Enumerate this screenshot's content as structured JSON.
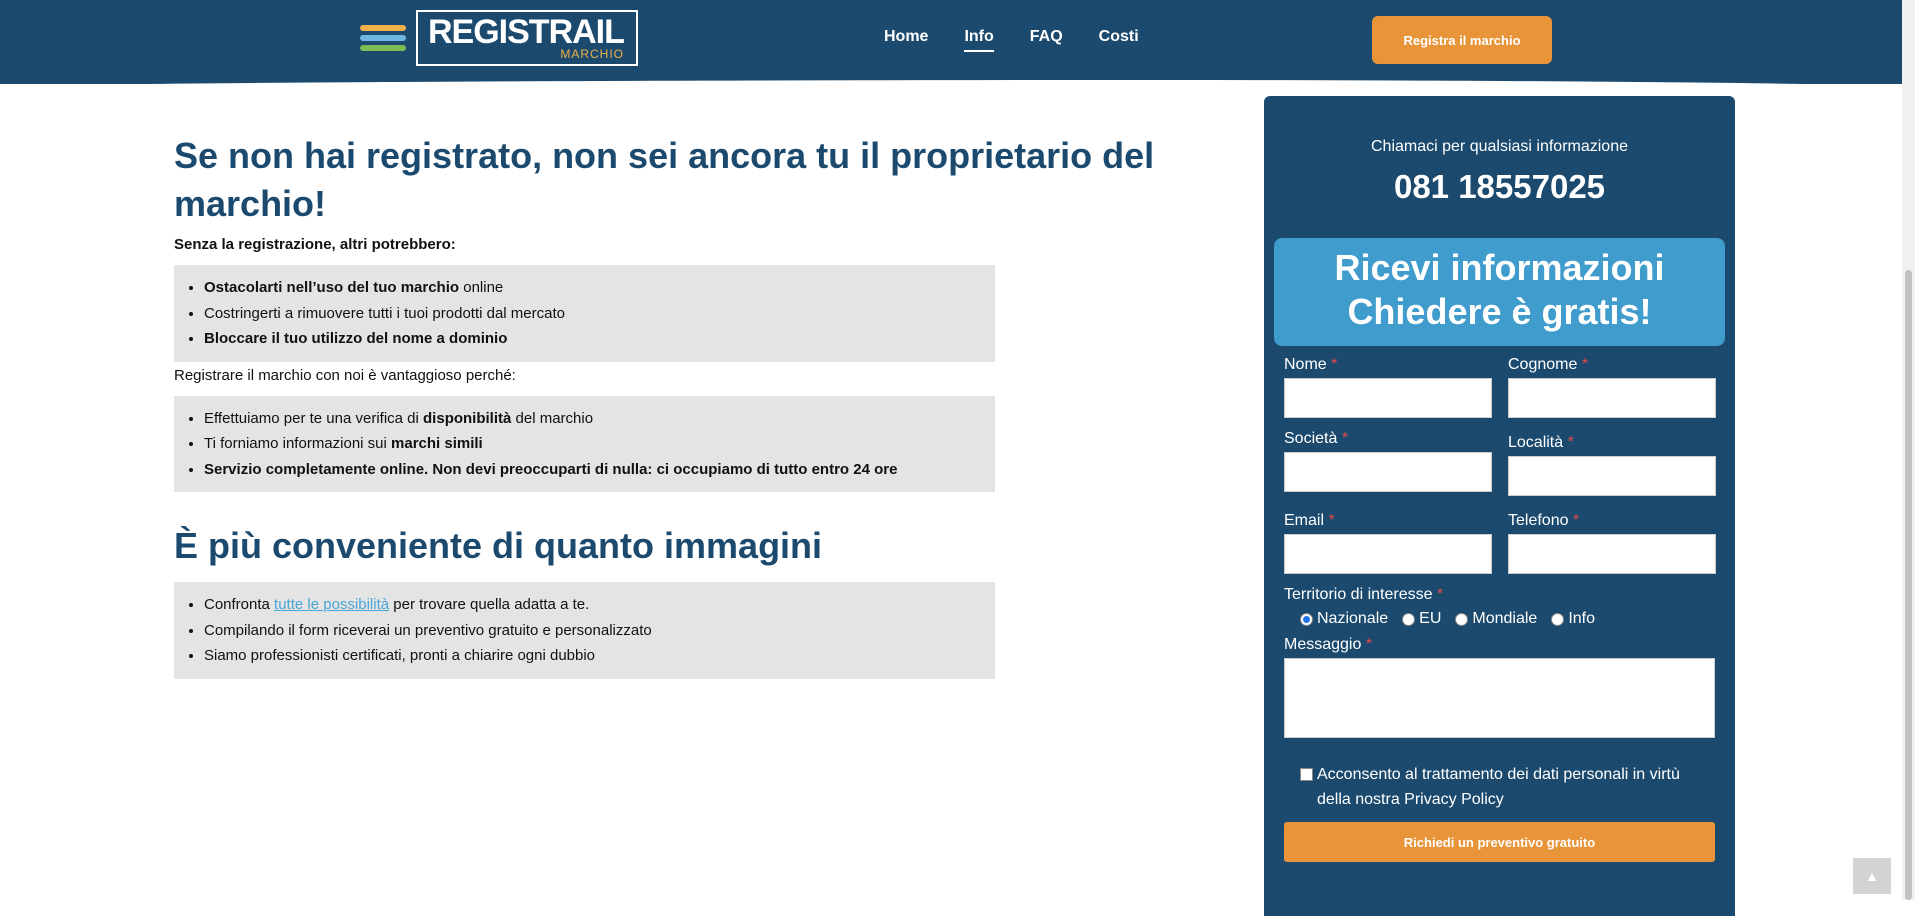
{
  "header": {
    "logo_text": "REGISTRAIL",
    "logo_sub": "MARCHIO",
    "logo_stripe_colors": [
      "#f0b04a",
      "#6fb7e3",
      "#7dbb55"
    ],
    "nav": [
      {
        "label": "Home",
        "active": false
      },
      {
        "label": "Info",
        "active": true
      },
      {
        "label": "FAQ",
        "active": false
      },
      {
        "label": "Costi",
        "active": false
      }
    ],
    "cta_label": "Registra il marchio"
  },
  "main": {
    "h1": "Se non hai registrato, non sei ancora tu il proprietario del marchio!",
    "lead": "Senza la registrazione, altri potrebbero:",
    "list1": [
      {
        "bold": "Ostacolarti nell’uso del tuo marchio",
        "rest": " online"
      },
      {
        "bold": "",
        "rest": "Costringerti a rimuovere tutti i tuoi prodotti dal mercato"
      },
      {
        "bold": "Bloccare il tuo utilizzo del nome a dominio",
        "rest": ""
      }
    ],
    "para2": "Registrare il marchio con noi è vantaggioso perché:",
    "list2": [
      {
        "pre": "Effettuiamo per te una verifica di ",
        "bold": "disponibilità",
        "post": " del marchio"
      },
      {
        "pre": "Ti forniamo informazioni sui ",
        "bold": "marchi simili",
        "post": ""
      },
      {
        "pre": "",
        "bold": "Servizio completamente online. Non devi preoccuparti di nulla: ci occupiamo di tutto entro 24 ore",
        "post": ""
      }
    ],
    "h2": "È più conveniente di quanto immagini",
    "list3": {
      "item1_pre": "Confronta ",
      "item1_link": "tutte le possibilità",
      "item1_post": " per trovare quella adatta a te.",
      "item2": "Compilando il form riceverai un preventivo gratuito e personalizzato",
      "item3": "Siamo professionisti certificati, pronti a chiarire ogni dubbio"
    }
  },
  "side": {
    "call_text": "Chiamaci per qualsiasi informazione",
    "phone": "081 18557025",
    "info_line1": "Ricevi informazioni",
    "info_line2": "Chiedere è gratis!",
    "form": {
      "nome": "Nome",
      "cognome": "Cognome",
      "societa": "Società",
      "localita": "Località",
      "email": "Email",
      "telefono": "Telefono",
      "territorio": "Territorio di interesse",
      "territorio_options": [
        {
          "label": "Nazionale",
          "selected": true
        },
        {
          "label": "EU",
          "selected": false
        },
        {
          "label": "Mondiale",
          "selected": false
        },
        {
          "label": "Info",
          "selected": false
        }
      ],
      "messaggio": "Messaggio",
      "required_mark": "*",
      "consent": "Acconsento al trattamento dei dati personali in virtù della nostra Privacy Policy",
      "submit": "Richiedi un preventivo gratuito"
    }
  },
  "colors": {
    "brand": "#1b4a6e",
    "accent": "#e8953a",
    "info_box": "#3f9ccc",
    "link": "#4aa4d6"
  },
  "icons": {
    "to_top": "arrow-up-icon"
  }
}
